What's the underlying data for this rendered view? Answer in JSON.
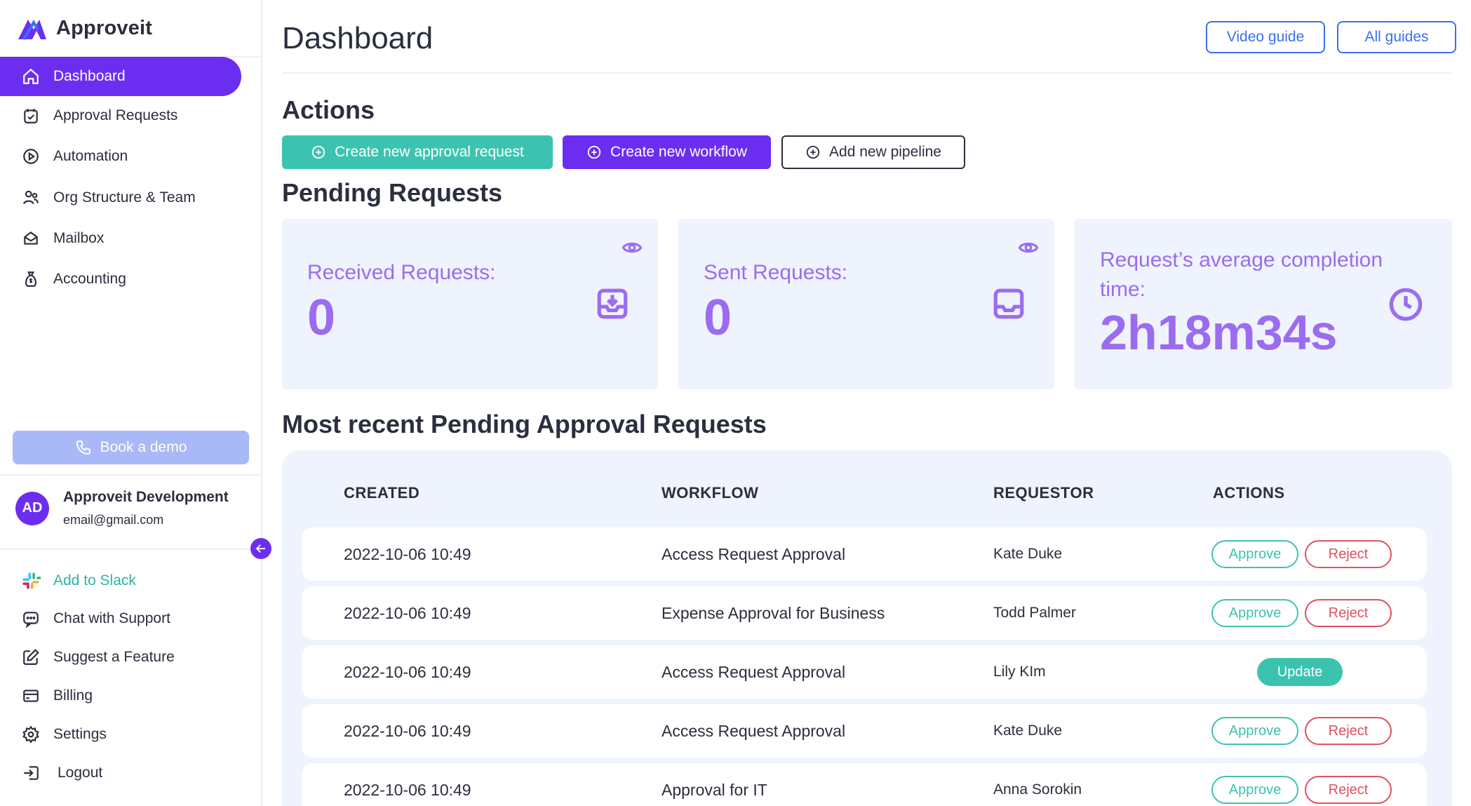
{
  "app": {
    "name": "Approveit"
  },
  "colors": {
    "primary": "#6b2ef0",
    "teal": "#3cc3b0",
    "reject": "#e0505f",
    "card_bg": "#eff3fd",
    "card_text": "#9b6cf0",
    "link_blue": "#3b6ef5"
  },
  "sidebar": {
    "items": [
      {
        "label": "Dashboard",
        "icon": "home-icon",
        "active": true
      },
      {
        "label": "Approval Requests",
        "icon": "calendar-check-icon"
      },
      {
        "label": "Automation",
        "icon": "play-circle-icon"
      },
      {
        "label": "Org Structure & Team",
        "icon": "users-icon"
      },
      {
        "label": "Mailbox",
        "icon": "mailbox-icon"
      },
      {
        "label": "Accounting",
        "icon": "money-bag-icon"
      }
    ],
    "book_demo": "Book a demo",
    "user": {
      "initials": "AD",
      "name": "Approveit Development",
      "email": "email@gmail.com"
    },
    "bottom": [
      {
        "label": "Add to Slack",
        "icon": "slack-icon"
      },
      {
        "label": "Chat with Support",
        "icon": "chat-icon"
      },
      {
        "label": "Suggest a Feature",
        "icon": "edit-icon"
      },
      {
        "label": "Billing",
        "icon": "card-icon"
      },
      {
        "label": "Settings",
        "icon": "gear-icon"
      },
      {
        "label": "Logout",
        "icon": "logout-icon"
      }
    ]
  },
  "header": {
    "title": "Dashboard",
    "video_guide": "Video guide",
    "all_guides": "All guides"
  },
  "actions": {
    "title": "Actions",
    "create_request": "Create new approval request",
    "create_workflow": "Create new workflow",
    "add_pipeline": "Add new pipeline"
  },
  "pending": {
    "title": "Pending Requests",
    "received_label": "Received Requests:",
    "received_value": "0",
    "sent_label": "Sent Requests:",
    "sent_value": "0",
    "avg_label_line1": "Request’s average completion",
    "avg_label_line2": "time:",
    "avg_value": "2h18m34s"
  },
  "recent": {
    "title": "Most recent Pending Approval Requests",
    "columns": [
      "CREATED",
      "WORKFLOW",
      "REQUESTOR",
      "ACTIONS"
    ],
    "approve_label": "Approve",
    "reject_label": "Reject",
    "update_label": "Update",
    "rows": [
      {
        "created": "2022-10-06 10:49",
        "workflow": "Access Request Approval",
        "requestor": "Kate Duke",
        "mode": "approve"
      },
      {
        "created": "2022-10-06 10:49",
        "workflow": "Expense Approval for Business",
        "requestor": "Todd Palmer",
        "mode": "approve"
      },
      {
        "created": "2022-10-06 10:49",
        "workflow": "Access Request Approval",
        "requestor": "Lily KIm",
        "mode": "update"
      },
      {
        "created": "2022-10-06 10:49",
        "workflow": "Access Request Approval",
        "requestor": "Kate Duke",
        "mode": "approve"
      },
      {
        "created": "2022-10-06 10:49",
        "workflow": "Approval for IT",
        "requestor": "Anna Sorokin",
        "mode": "approve"
      }
    ]
  }
}
